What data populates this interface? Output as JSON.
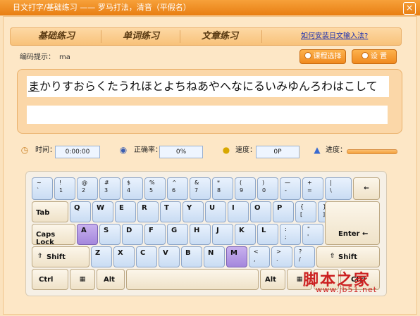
{
  "window": {
    "title": "日文打字/基础练习 —— 罗马打法，清音（平假名）",
    "close": "×"
  },
  "tabs": [
    {
      "label": "基础练习"
    },
    {
      "label": "单词练习"
    },
    {
      "label": "文章练习"
    }
  ],
  "help_link": "如何安装日文输入法?",
  "hint": {
    "label": "编码提示：",
    "value": "ma"
  },
  "buttons": {
    "course": "课程选择",
    "settings": "设 置"
  },
  "text": {
    "first": "ま",
    "rest": "かりすおらくたうれほとよちねあやへなにるいみゆんろわはこして"
  },
  "stats": {
    "time_label": "时间：",
    "time": "0:00:00",
    "accuracy_label": "正确率：",
    "accuracy": "0%",
    "speed_label": "速度：",
    "speed": "0P",
    "progress_label": "进度："
  },
  "colors": {
    "accent": "#f08a1e",
    "key_blue": "#c9dcf3",
    "highlight": "#a487dc"
  },
  "keys": {
    "row1": [
      [
        "~",
        "`"
      ],
      [
        "!",
        "1"
      ],
      [
        "@",
        "2"
      ],
      [
        "#",
        "3"
      ],
      [
        "$",
        "4"
      ],
      [
        "%",
        "5"
      ],
      [
        "^",
        "6"
      ],
      [
        "&",
        "7"
      ],
      [
        "*",
        "8"
      ],
      [
        "(",
        "9"
      ],
      [
        ")",
        "0"
      ],
      [
        "—",
        "-"
      ],
      [
        "+",
        "="
      ],
      [
        "|",
        "\\"
      ]
    ],
    "backspace": "←",
    "tab": "Tab",
    "row2": [
      "Q",
      "W",
      "E",
      "R",
      "T",
      "Y",
      "U",
      "I",
      "O",
      "P"
    ],
    "row2sym": [
      [
        "{",
        "["
      ],
      [
        "}",
        "]"
      ]
    ],
    "caps": "Caps Lock",
    "row3": [
      "A",
      "S",
      "D",
      "F",
      "G",
      "H",
      "J",
      "K",
      "L"
    ],
    "row3sym": [
      [
        ":",
        ";"
      ],
      [
        "\"",
        "'"
      ]
    ],
    "enter": "Enter",
    "shift": "Shift",
    "row4": [
      "Z",
      "X",
      "C",
      "V",
      "B",
      "N",
      "M"
    ],
    "row4sym": [
      [
        "<",
        ","
      ],
      [
        ">",
        "."
      ],
      [
        "?",
        "/"
      ]
    ],
    "ctrl": "Ctrl",
    "alt": "Alt"
  },
  "watermark": {
    "main": "脚本之家",
    "url": "www.jb51.net"
  }
}
